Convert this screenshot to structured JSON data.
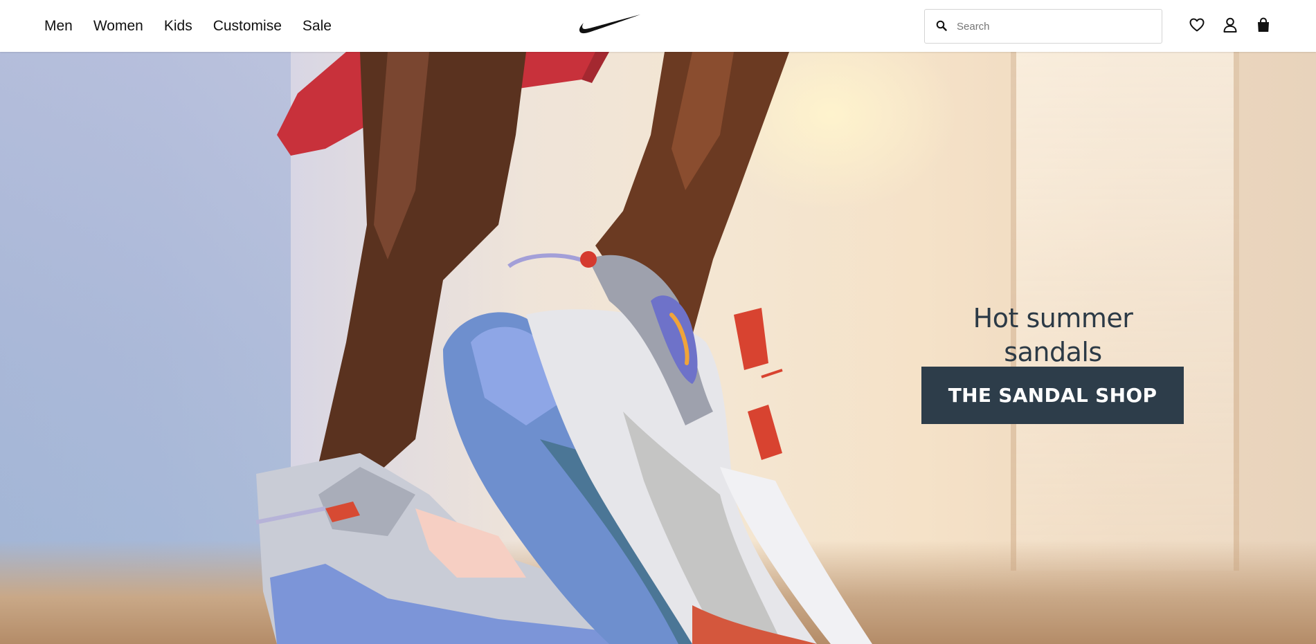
{
  "header": {
    "nav": [
      {
        "label": "Men"
      },
      {
        "label": "Women"
      },
      {
        "label": "Kids"
      },
      {
        "label": "Customise"
      },
      {
        "label": "Sale"
      }
    ],
    "logo_icon": "swoosh-logo",
    "search": {
      "placeholder": "Search",
      "value": "",
      "icon": "search-icon"
    },
    "actions": [
      {
        "icon": "heart-icon"
      },
      {
        "icon": "user-icon"
      },
      {
        "icon": "bag-icon"
      }
    ]
  },
  "hero": {
    "title": "Hot summer sandals",
    "cta_label": "THE SANDAL SHOP",
    "colors": {
      "cta_bg": "#2d3d4a",
      "title": "#2c3a46"
    }
  }
}
